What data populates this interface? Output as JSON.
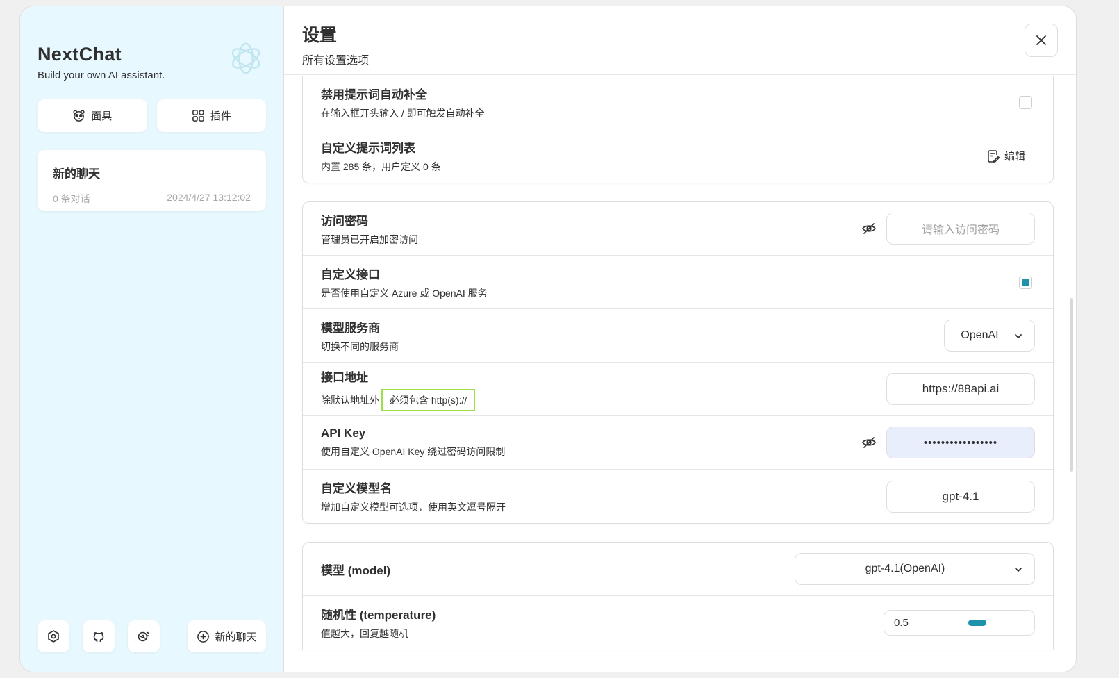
{
  "sidebar": {
    "brand_title": "NextChat",
    "brand_subtitle": "Build your own AI assistant.",
    "mask_label": "面具",
    "plugin_label": "插件",
    "chat": {
      "title": "新的聊天",
      "count": "0 条对话",
      "time": "2024/4/27 13:12:02"
    },
    "new_chat_label": "新的聊天"
  },
  "header": {
    "title": "设置",
    "subtitle": "所有设置选项"
  },
  "settings": {
    "disable_autocomplete": {
      "title": "禁用提示词自动补全",
      "sub": "在输入框开头输入 / 即可触发自动补全",
      "checked": false
    },
    "prompt_list": {
      "title": "自定义提示词列表",
      "sub": "内置 285 条，用户定义 0 条",
      "edit_label": "编辑"
    },
    "access_code": {
      "title": "访问密码",
      "sub": "管理员已开启加密访问",
      "placeholder": "请输入访问密码"
    },
    "custom_endpoint": {
      "title": "自定义接口",
      "sub": "是否使用自定义 Azure 或 OpenAI 服务",
      "checked": true
    },
    "provider": {
      "title": "模型服务商",
      "sub": "切换不同的服务商",
      "value": "OpenAI"
    },
    "endpoint": {
      "title": "接口地址",
      "sub": "除默认地址外",
      "sub_highlight": "必须包含 http(s)://",
      "value": "https://88api.ai"
    },
    "api_key": {
      "title": "API Key",
      "sub": "使用自定义 OpenAI Key 绕过密码访问限制",
      "value": "•••••••••••••••••"
    },
    "custom_models": {
      "title": "自定义模型名",
      "sub": "增加自定义模型可选项，使用英文逗号隔开",
      "value": "gpt-4.1"
    },
    "model": {
      "title": "模型 (model)",
      "value": "gpt-4.1(OpenAI)"
    },
    "temperature": {
      "title": "随机性 (temperature)",
      "sub": "值越大，回复越随机",
      "value": "0.5"
    }
  },
  "colors": {
    "accent": "#1d93ab",
    "sidebar_bg": "#e7f8ff",
    "highlight_border": "#9fe04a"
  }
}
